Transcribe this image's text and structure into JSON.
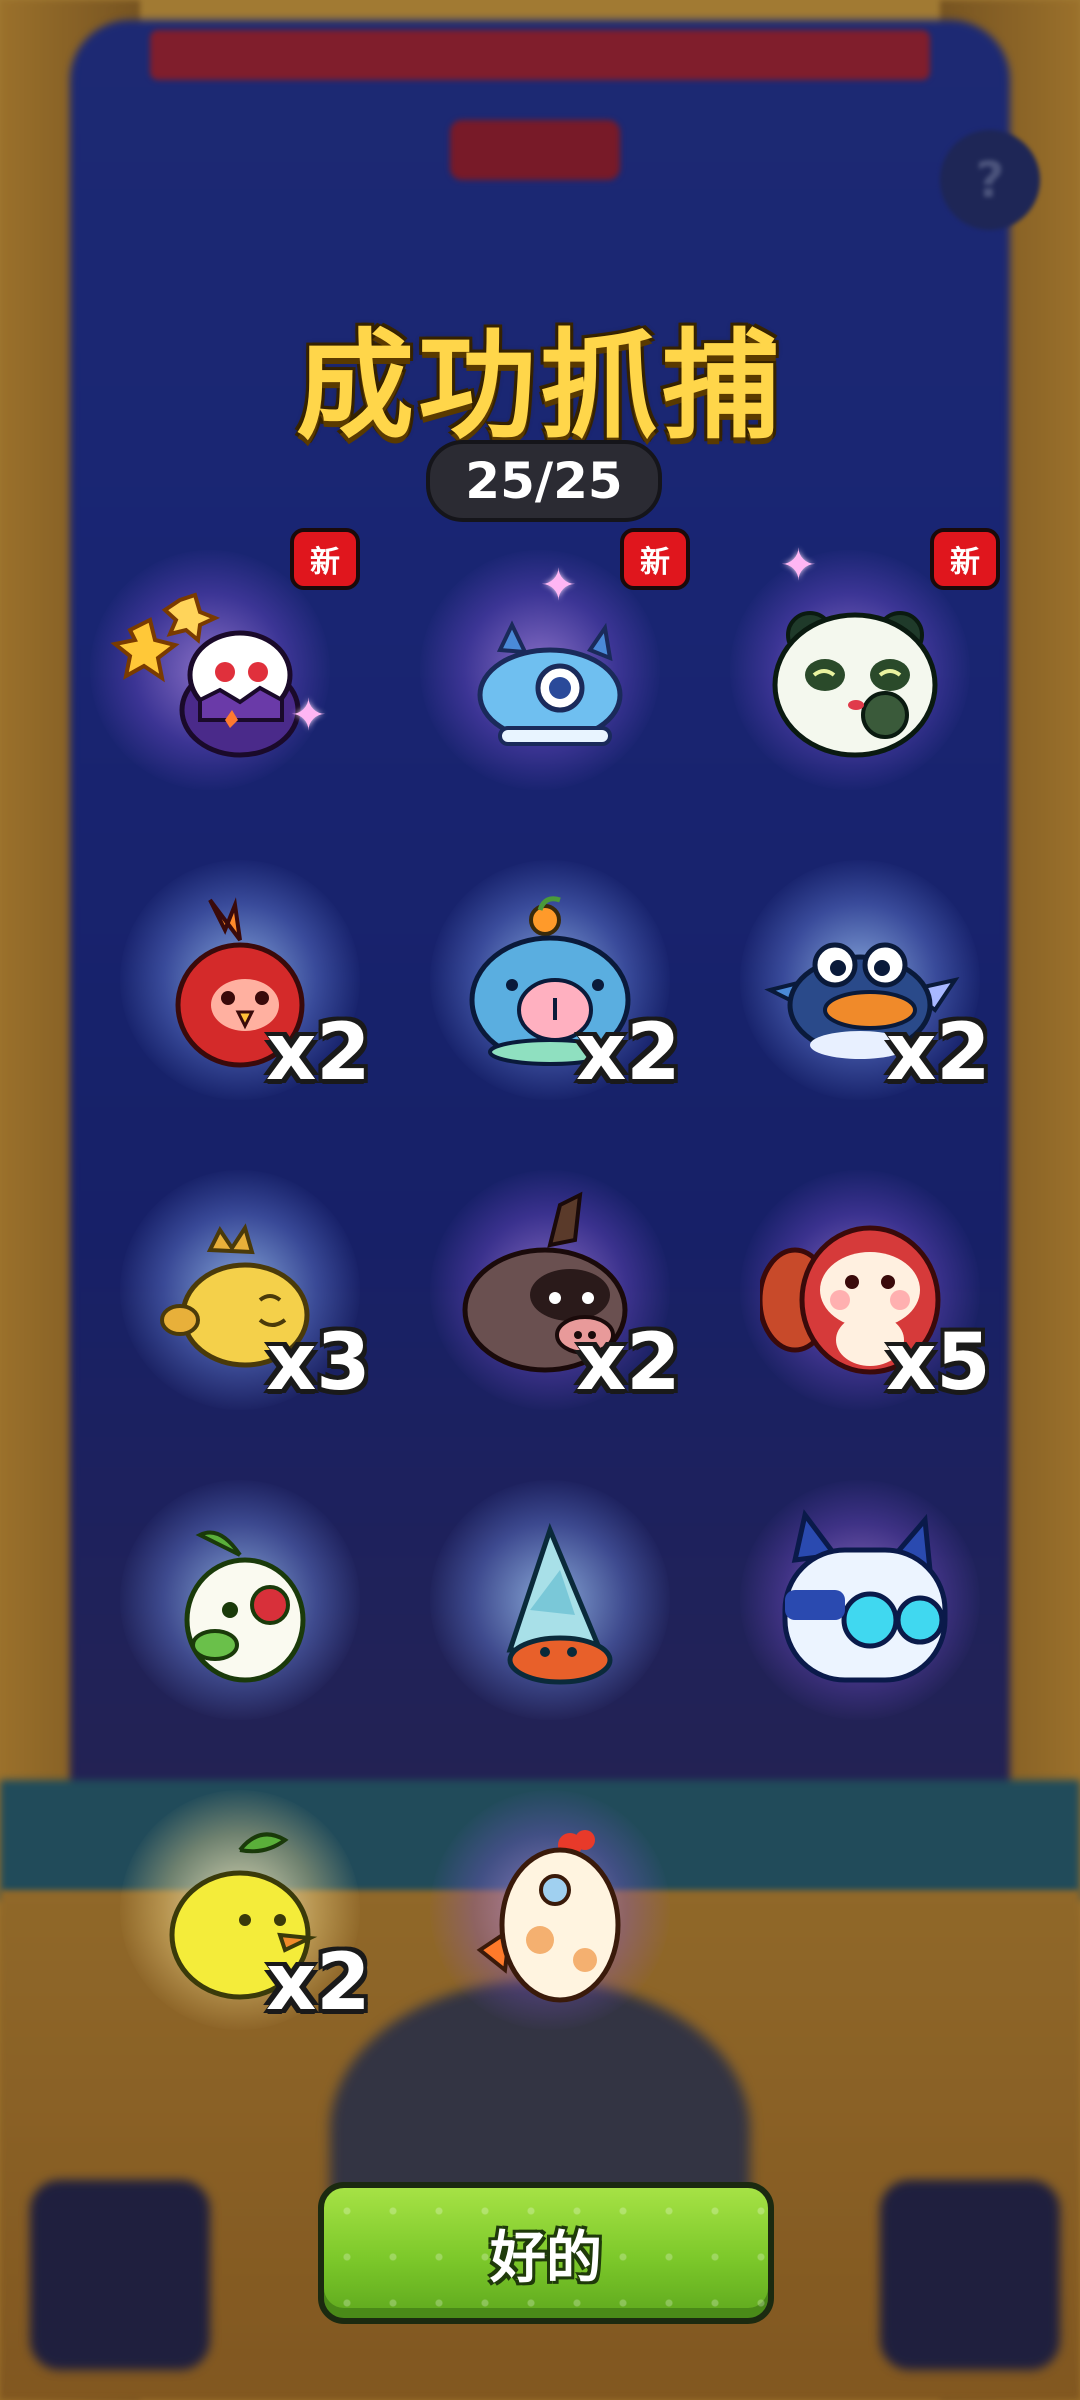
{
  "title": "成功抓捕",
  "counter": "25/25",
  "new_badge": "新",
  "ok_button": "好的",
  "help_icon": "?",
  "colors": {
    "title": "#ffd64a",
    "button": "#8bd334",
    "badge": "#e0161d"
  },
  "creatures": [
    {
      "icon": "cracked-egg-bunny-icon",
      "count": "",
      "is_new": true
    },
    {
      "icon": "blue-dragon-icon",
      "count": "",
      "is_new": true
    },
    {
      "icon": "panda-icon",
      "count": "",
      "is_new": true
    },
    {
      "icon": "red-bird-icon",
      "count": "x2",
      "is_new": false
    },
    {
      "icon": "blue-capybara-icon",
      "count": "x2",
      "is_new": false
    },
    {
      "icon": "blue-frog-icon",
      "count": "x2",
      "is_new": false
    },
    {
      "icon": "yellow-chick-icon",
      "count": "x3",
      "is_new": false
    },
    {
      "icon": "boar-icon",
      "count": "x2",
      "is_new": false
    },
    {
      "icon": "red-hamster-icon",
      "count": "x5",
      "is_new": false
    },
    {
      "icon": "sprout-bird-icon",
      "count": "",
      "is_new": false
    },
    {
      "icon": "hermit-crab-icon",
      "count": "",
      "is_new": false
    },
    {
      "icon": "robot-cat-icon",
      "count": "",
      "is_new": false
    },
    {
      "icon": "pear-duck-icon",
      "count": "x2",
      "is_new": false
    },
    {
      "icon": "chicken-icon",
      "count": "",
      "is_new": false
    }
  ]
}
